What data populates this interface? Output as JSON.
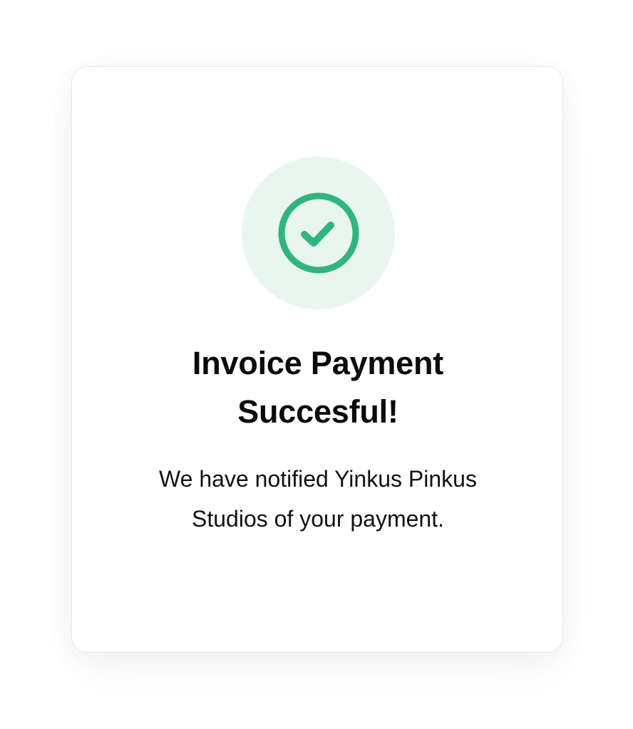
{
  "colors": {
    "success_green": "#2fb57d",
    "success_circle_bg": "#e9f6f0",
    "card_bg": "#ffffff",
    "text": "#0b0b0b"
  },
  "icon": {
    "name": "check-circle-icon"
  },
  "dialog": {
    "title_lines": [
      "Invoice Payment",
      "Succesful!"
    ],
    "message_lines": [
      "We have notified Yinkus Pinkus",
      "Studios of your payment."
    ]
  }
}
